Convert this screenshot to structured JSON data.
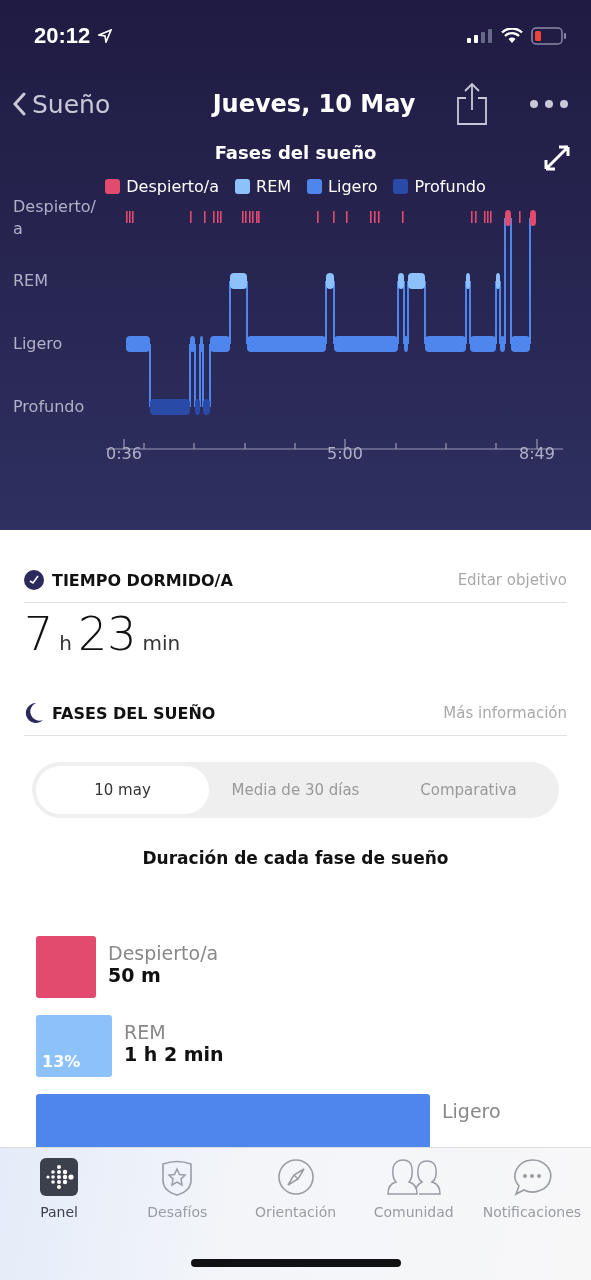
{
  "status_bar": {
    "time": "20:12"
  },
  "nav": {
    "back": "Sueño",
    "title": "Jueves, 10 May"
  },
  "chart": {
    "title": "Fases del sueño",
    "legend": [
      {
        "label": "Despierto/a",
        "color": "#e24a6e"
      },
      {
        "label": "REM",
        "color": "#8cc1fa"
      },
      {
        "label": "Ligero",
        "color": "#4f86ee"
      },
      {
        "label": "Profundo",
        "color": "#2a4aa8"
      }
    ],
    "y_labels": [
      "Despierto/\na",
      "REM",
      "Ligero",
      "Profundo"
    ],
    "x_labels": [
      "0:36",
      "5:00",
      "8:49"
    ]
  },
  "sleep_time": {
    "heading": "TIEMPO DORMIDO/A",
    "action": "Editar objetivo",
    "hours": "7",
    "hours_unit": "h",
    "minutes": "23",
    "minutes_unit": "min"
  },
  "stages": {
    "heading": "FASES DEL SUEÑO",
    "action": "Más información",
    "segments": [
      {
        "label": "10 may",
        "selected": true
      },
      {
        "label": "Media de 30 días",
        "selected": false
      },
      {
        "label": "Comparativa",
        "selected": false
      }
    ],
    "subtitle": "Duración de cada fase de sueño",
    "bars": [
      {
        "label": "Despierto/a",
        "value": "50 m",
        "color": "#e24a6e"
      },
      {
        "label": "REM",
        "value": "1 h 2 min",
        "percent": "13%",
        "color": "#8cc1fa"
      },
      {
        "label": "Ligero",
        "color": "#4f86ee"
      }
    ]
  },
  "tabs": [
    {
      "label": "Panel",
      "selected": true
    },
    {
      "label": "Desafíos",
      "selected": false
    },
    {
      "label": "Orientación",
      "selected": false
    },
    {
      "label": "Comunidad",
      "selected": false
    },
    {
      "label": "Notificaciones",
      "selected": false
    }
  ]
}
